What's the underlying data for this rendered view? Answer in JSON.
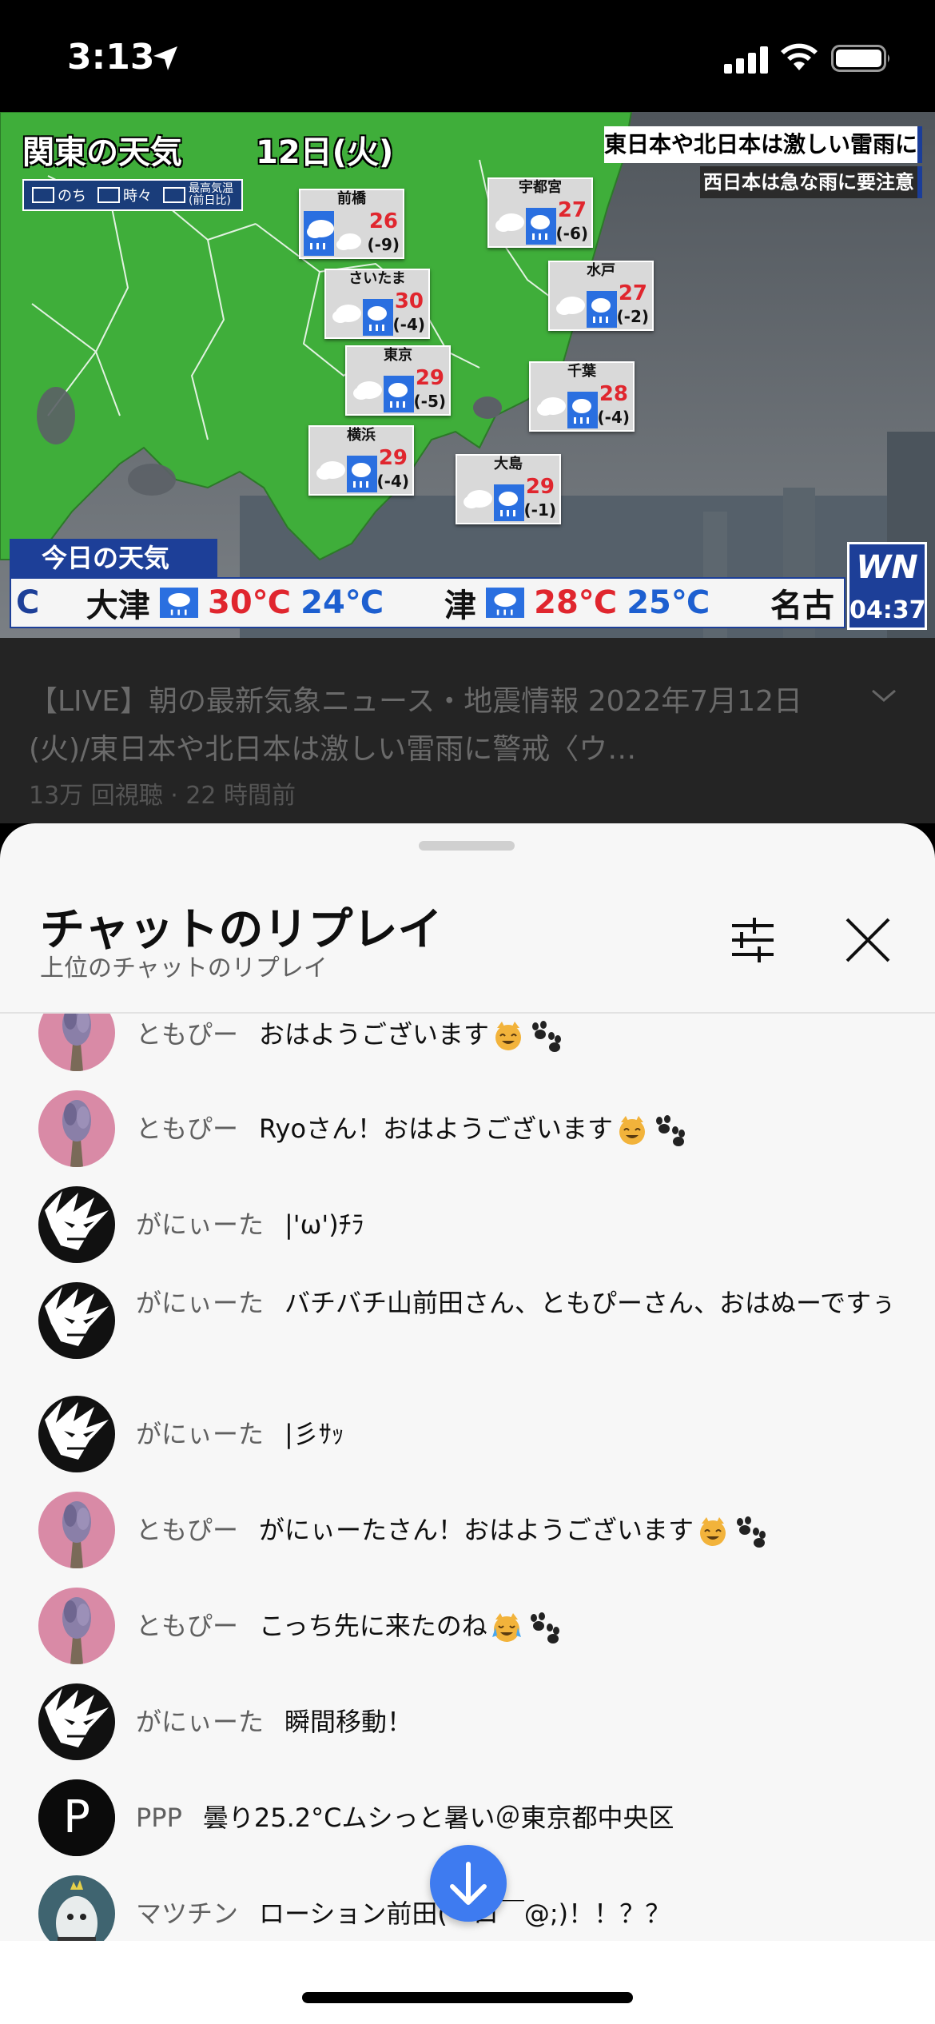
{
  "status_bar": {
    "time": "3:13"
  },
  "video": {
    "title": "関東の天気",
    "date": "12日(火)",
    "legend": [
      "のち",
      "時々",
      "最高気温",
      "(前日比)"
    ],
    "alert_main": "東日本や北日本は激しい雷雨に警戒",
    "alert_sub": "西日本は急な雨に要注意",
    "cities": [
      {
        "name": "前橋",
        "temp": "26",
        "diff": "(-9)"
      },
      {
        "name": "宇都宮",
        "temp": "27",
        "diff": "(-6)"
      },
      {
        "name": "さいたま",
        "temp": "30",
        "diff": "(-4)"
      },
      {
        "name": "水戸",
        "temp": "27",
        "diff": "(-2)"
      },
      {
        "name": "東京",
        "temp": "29",
        "diff": "(-5)"
      },
      {
        "name": "千葉",
        "temp": "28",
        "diff": "(-4)"
      },
      {
        "name": "横浜",
        "temp": "29",
        "diff": "(-4)"
      },
      {
        "name": "大島",
        "temp": "29",
        "diff": "(-1)"
      }
    ],
    "today_label": "今日の天気",
    "ticker": {
      "c": "C",
      "city1": "大津",
      "hi1": "30℃",
      "lo1": "24℃",
      "city2": "津",
      "hi2": "28℃",
      "lo2": "25℃",
      "city3": "名古"
    },
    "logo": "WN",
    "clock": "04:37"
  },
  "info": {
    "title": "【LIVE】朝の最新気象ニュース・地震情報 2022年7月12日(火)/東日本や北日本は激しい雷雨に警戒〈ウ…",
    "meta": "13万 回視聴 · 22 時間前"
  },
  "sheet": {
    "title": "チャットのリプレイ",
    "subtitle": "上位のチャットのリプレイ"
  },
  "messages": [
    {
      "author": "ともぴー",
      "text": "おはようございます",
      "avatar": "lavender",
      "emoji": [
        "cat-smile-emoji",
        "paw-emoji"
      ]
    },
    {
      "author": "ともぴー",
      "text": "Ryoさん！おはようございます",
      "avatar": "lavender",
      "emoji": [
        "cat-smile-emoji",
        "paw-emoji"
      ]
    },
    {
      "author": "がにぃーた",
      "text": "|'ω')ﾁﾗ",
      "avatar": "dark",
      "emoji": []
    },
    {
      "author": "がにぃーた",
      "text": "バチバチ山前田さん、ともぴーさん、おはぬーですぅ",
      "avatar": "dark",
      "emoji": []
    },
    {
      "author": "がにぃーた",
      "text": "|彡ｻｯ",
      "avatar": "dark",
      "emoji": []
    },
    {
      "author": "ともぴー",
      "text": "がにぃーたさん！おはようございます",
      "avatar": "lavender",
      "emoji": [
        "cat-smile-emoji",
        "paw-emoji"
      ]
    },
    {
      "author": "ともぴー",
      "text": "こっち先に来たのね",
      "avatar": "lavender",
      "emoji": [
        "cat-tears-emoji",
        "paw-emoji"
      ]
    },
    {
      "author": "がにぃーた",
      "text": "瞬間移動！",
      "avatar": "dark",
      "emoji": []
    },
    {
      "author": "PPP",
      "text": "曇り25.2°Cムシっと暑い＠東京都中央区",
      "avatar": "letter-p",
      "avatar_letter": "P",
      "emoji": []
    },
    {
      "author": "マツチン",
      "text": "ローション前田(￣ロ￣@;)！！？？",
      "avatar": "ghost",
      "emoji": []
    }
  ],
  "colors": {
    "fab": "#3e7bf0",
    "author": "#606060",
    "temp_red": "#e0262e",
    "ticker_blue": "#1d3f98"
  }
}
